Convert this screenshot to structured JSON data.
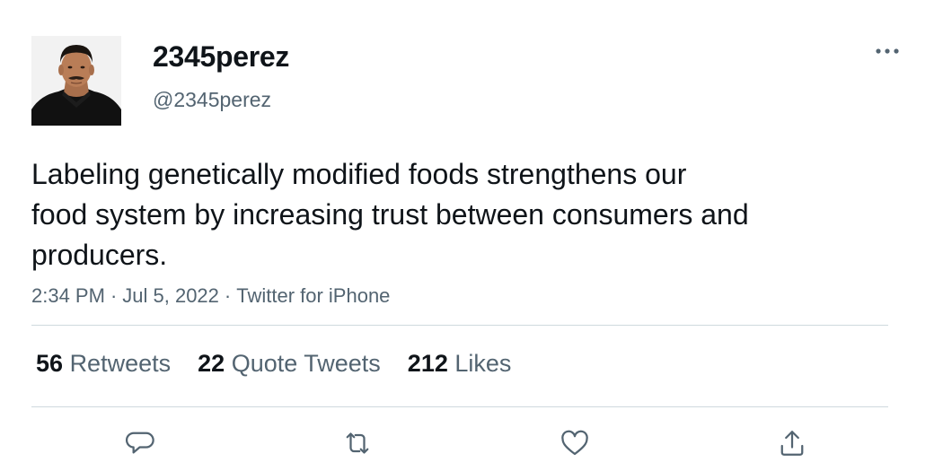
{
  "tweet": {
    "display_name": "2345perez",
    "handle": "@2345perez",
    "text": "Labeling genetically modified foods strengthens our\nfood system by increasing trust between consumers and\nproducers.",
    "time": "2:34 PM",
    "date": "Jul 5, 2022",
    "source": "Twitter for iPhone",
    "separator": "·"
  },
  "stats": {
    "retweets_count": "56",
    "retweets_label": "Retweets",
    "quotes_count": "22",
    "quotes_label": "Quote Tweets",
    "likes_count": "212",
    "likes_label": "Likes"
  },
  "icons": {
    "more": "more-horizontal-icon",
    "reply": "reply-icon",
    "retweet": "retweet-icon",
    "like": "heart-icon",
    "share": "share-icon"
  },
  "colors": {
    "text_primary": "#0f1419",
    "text_secondary": "#536471",
    "divider": "#cfd9de",
    "icon": "#536471"
  }
}
